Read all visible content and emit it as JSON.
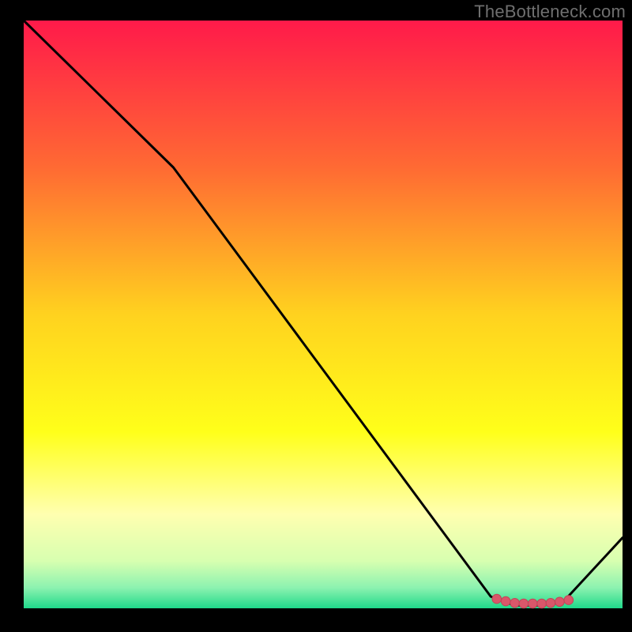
{
  "watermark": "TheBottleneck.com",
  "colors": {
    "background": "#000000",
    "line": "#000000",
    "marker_fill": "#d9576a",
    "marker_stroke": "#c24557"
  },
  "chart_data": {
    "type": "line",
    "title": "",
    "xlabel": "",
    "ylabel": "",
    "xlim": [
      0,
      100
    ],
    "ylim": [
      0,
      100
    ],
    "grid": false,
    "legend": false,
    "gradient_stops": [
      {
        "pos": 0.0,
        "color": "#ff1a4a"
      },
      {
        "pos": 0.25,
        "color": "#ff6a33"
      },
      {
        "pos": 0.5,
        "color": "#ffd21f"
      },
      {
        "pos": 0.7,
        "color": "#ffff1a"
      },
      {
        "pos": 0.84,
        "color": "#ffffb0"
      },
      {
        "pos": 0.92,
        "color": "#d7ffb0"
      },
      {
        "pos": 0.965,
        "color": "#8cf2b0"
      },
      {
        "pos": 1.0,
        "color": "#1fd98a"
      }
    ],
    "series": [
      {
        "name": "bottleneck-curve",
        "x": [
          0,
          25,
          78,
          82,
          86,
          90,
          100
        ],
        "y": [
          100,
          75,
          2,
          0.5,
          0.5,
          1,
          12
        ]
      }
    ],
    "markers": {
      "name": "highlight-points",
      "x": [
        79,
        80.5,
        82,
        83.5,
        85,
        86.5,
        88,
        89.5,
        91
      ],
      "y": [
        1.6,
        1.2,
        0.9,
        0.8,
        0.8,
        0.8,
        0.9,
        1.1,
        1.4
      ]
    }
  }
}
